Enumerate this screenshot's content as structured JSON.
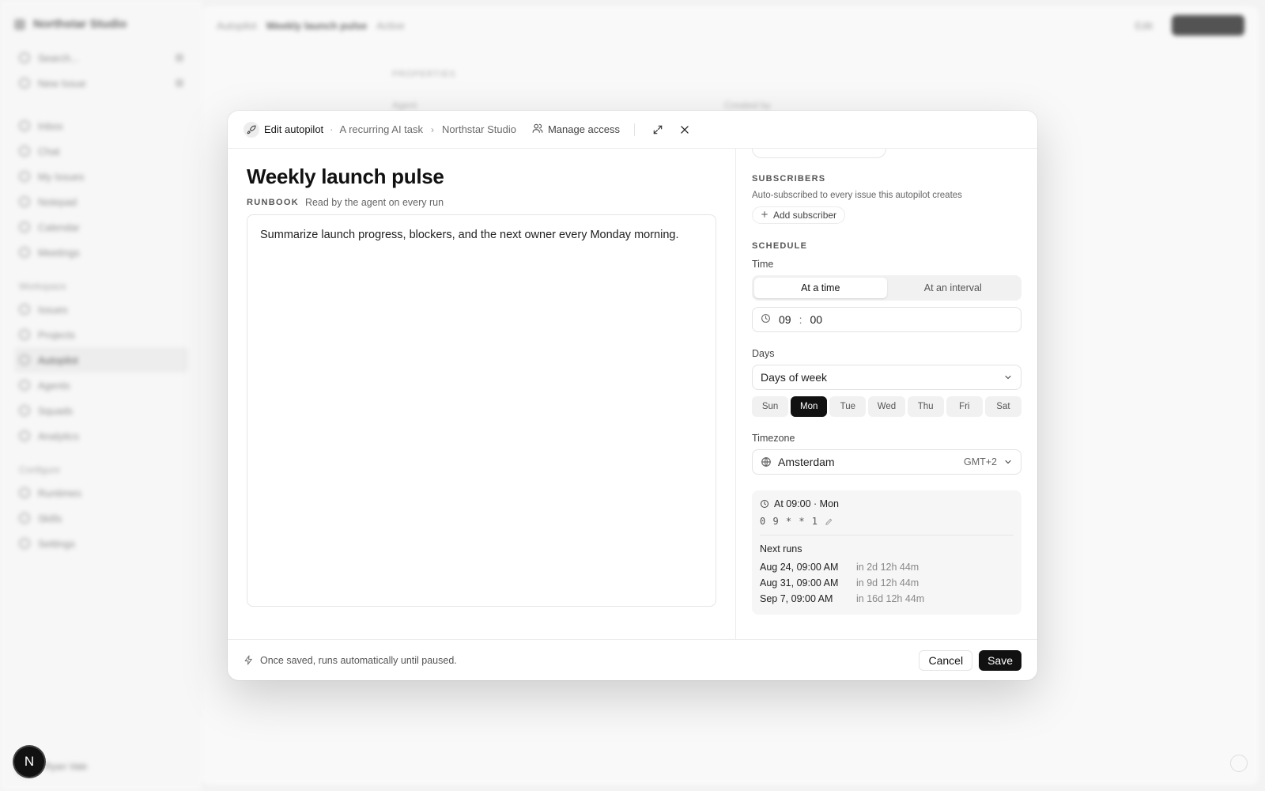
{
  "bg": {
    "workspace": "Northstar Studio",
    "search": "Search...",
    "new_issue": "New Issue",
    "nav": [
      "Inbox",
      "Chat",
      "My Issues",
      "Notepad",
      "Calendar",
      "Meetings"
    ],
    "workspace_head": "Workspace",
    "workspace_nav": [
      "Issues",
      "Projects",
      "Autopilot",
      "Agents",
      "Squads",
      "Analytics"
    ],
    "config_head": "Configure",
    "config_nav": [
      "Runtimes",
      "Skills",
      "Settings"
    ],
    "breadcrumb_root": "Autopilot",
    "breadcrumb_page": "Weekly launch pulse",
    "status": "Active",
    "edit": "Edit",
    "props": "PROPERTIES",
    "agent": "Agent",
    "created_by": "Created by",
    "user": "Ryan Vale"
  },
  "logo": "N",
  "modal": {
    "header": {
      "title": "Edit autopilot",
      "subtitle": "A recurring AI task",
      "workspace": "Northstar Studio",
      "manage_access": "Manage access"
    },
    "left": {
      "title": "Weekly launch pulse",
      "runbook_label": "RUNBOOK",
      "runbook_hint": "Read by the agent on every run",
      "runbook_text": "Summarize launch progress, blockers, and the next owner every Monday morning."
    },
    "right": {
      "subscribers_head": "SUBSCRIBERS",
      "subscribers_sub": "Auto-subscribed to every issue this autopilot creates",
      "add_subscriber": "Add subscriber",
      "schedule_head": "SCHEDULE",
      "time_label": "Time",
      "time_modes": [
        "At a time",
        "At an interval"
      ],
      "hour": "09",
      "sep": ":",
      "minute": "00",
      "days_label": "Days",
      "days_mode": "Days of week",
      "days": [
        "Sun",
        "Mon",
        "Tue",
        "Wed",
        "Thu",
        "Fri",
        "Sat"
      ],
      "selected_day": "Mon",
      "tz_label": "Timezone",
      "tz": "Amsterdam",
      "tz_offset": "GMT+2",
      "summary": "At 09:00 · Mon",
      "cron": "0 9 * * 1",
      "next_runs_label": "Next runs",
      "next_runs": [
        {
          "date": "Aug 24, 09:00 AM",
          "rel": "in 2d 12h 44m"
        },
        {
          "date": "Aug 31, 09:00 AM",
          "rel": "in 9d 12h 44m"
        },
        {
          "date": "Sep 7, 09:00 AM",
          "rel": "in 16d 12h 44m"
        }
      ]
    },
    "footer": {
      "note": "Once saved, runs automatically until paused.",
      "cancel": "Cancel",
      "save": "Save"
    }
  }
}
